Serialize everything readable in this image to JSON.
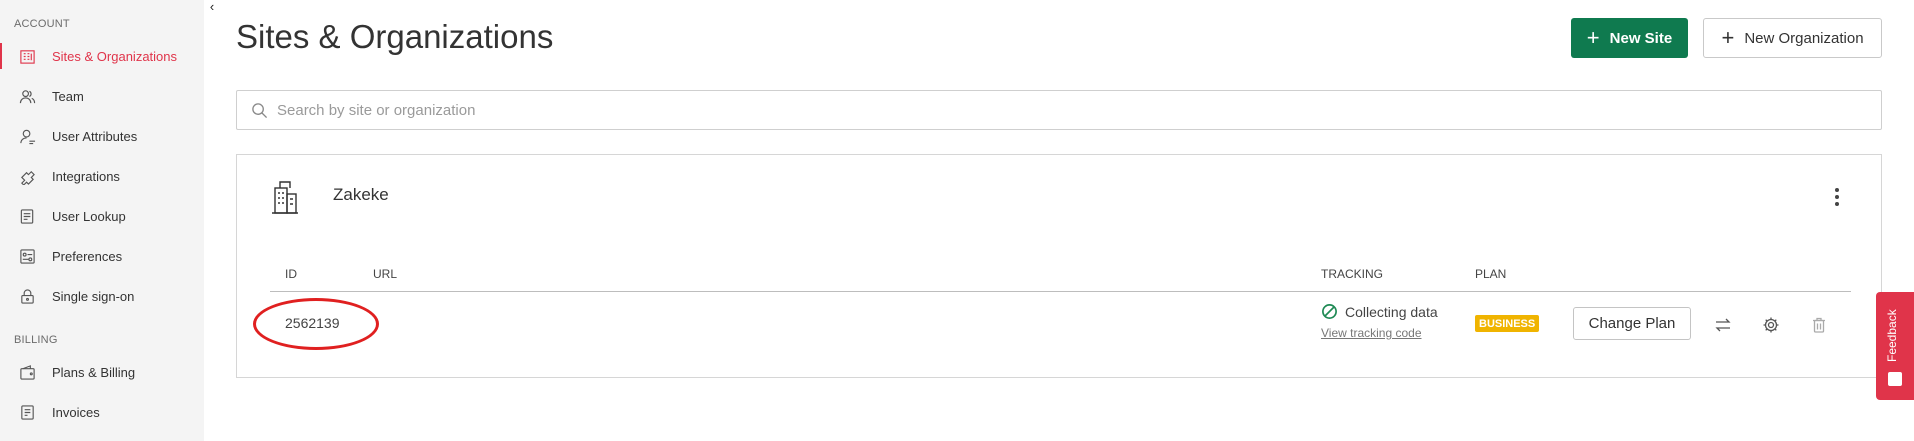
{
  "sidebar": {
    "account_label": "ACCOUNT",
    "billing_label": "BILLING",
    "items": [
      {
        "label": "Sites & Organizations",
        "icon": "building-icon",
        "active": true
      },
      {
        "label": "Team",
        "icon": "users-icon"
      },
      {
        "label": "User Attributes",
        "icon": "user-attributes-icon"
      },
      {
        "label": "Integrations",
        "icon": "puzzle-icon"
      },
      {
        "label": "User Lookup",
        "icon": "user-lookup-icon"
      },
      {
        "label": "Preferences",
        "icon": "preferences-icon"
      },
      {
        "label": "Single sign-on",
        "icon": "lock-icon"
      },
      {
        "label": "Plans & Billing",
        "icon": "wallet-icon"
      },
      {
        "label": "Invoices",
        "icon": "invoice-icon"
      }
    ],
    "collapse_glyph": "‹"
  },
  "header": {
    "title": "Sites & Organizations",
    "new_site_label": "New Site",
    "new_org_label": "New Organization"
  },
  "search": {
    "placeholder": "Search by site or organization",
    "value": ""
  },
  "org": {
    "name": "Zakeke",
    "columns": {
      "id": "ID",
      "url": "URL",
      "tracking": "TRACKING",
      "plan": "PLAN"
    },
    "sites": [
      {
        "id": "2562139",
        "url": "",
        "tracking_status": "Collecting data",
        "tracking_link": "View tracking code",
        "plan": "BUSINESS",
        "change_plan_label": "Change Plan"
      }
    ]
  },
  "feedback": {
    "label": "Feedback"
  },
  "colors": {
    "accent": "#e0344a",
    "primary": "#0f7a4f",
    "badge": "#f0b400",
    "annotation": "#e02020"
  }
}
